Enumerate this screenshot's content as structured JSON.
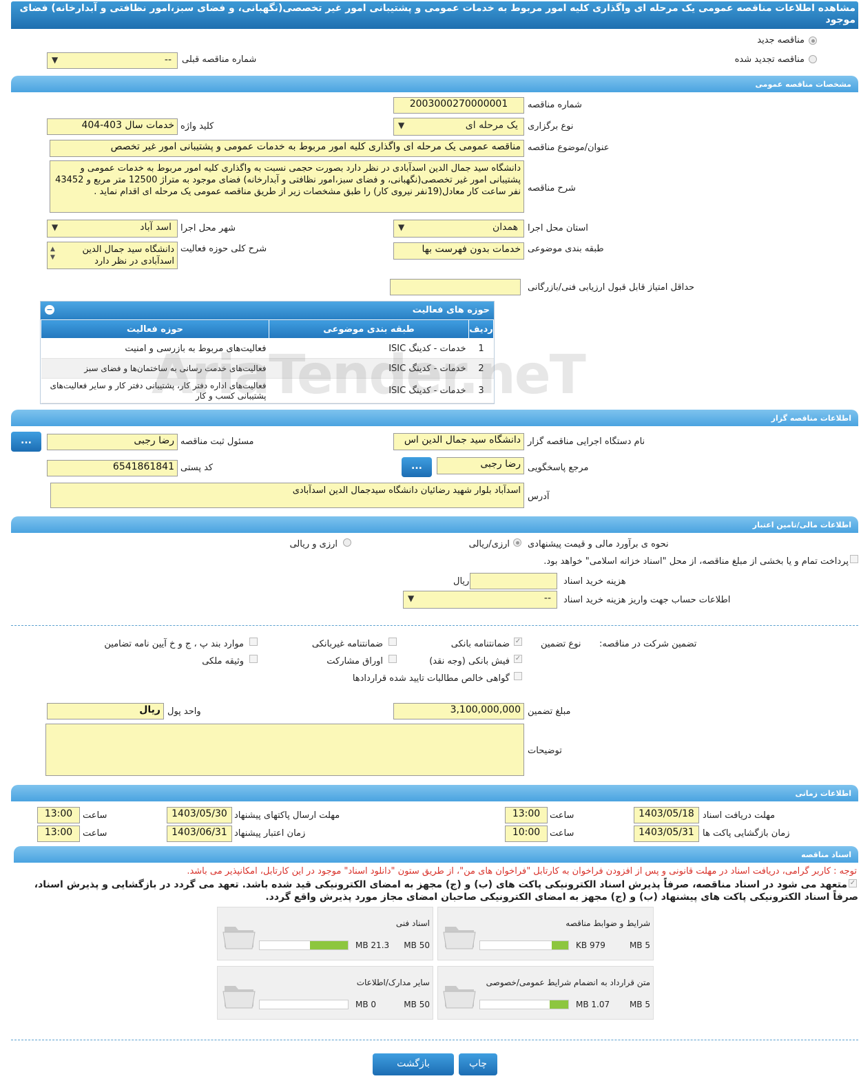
{
  "title": "مشاهده اطلاعات مناقصه عمومی یک مرحله ای واگذاری کلیه امور مربوط به خدمات عمومی و پشتیبانی امور غیر تخصصی(نگهبانی، و فضای سبز،امور نظافتی و آبدارخانه) فضای موجود",
  "tender_type": {
    "new": "مناقصه جدید",
    "renewed": "مناقصه تجدید شده",
    "prev_label": "شماره مناقصه قبلی",
    "prev_value": "--"
  },
  "general": {
    "section": "مشخصات مناقصه عمومی",
    "number_label": "شماره مناقصه",
    "number": "2003000270000001",
    "hold_label": "نوع برگزاری",
    "hold": "یک مرحله ای",
    "keyword_label": "کلید واژه",
    "keyword": "خدمات سال 403-404",
    "subject_label": "عنوان/موضوع مناقصه",
    "subject": "مناقصه عمومی یک مرحله ای واگذاری کلیه امور مربوط به خدمات عمومی و پشتیبانی امور غیر تخصص",
    "desc_label": "شرح مناقصه",
    "desc": "دانشگاه سید جمال الدین اسدآبادی در نظر دارد بصورت حجمی نسبت به واگذاری کلیه امور مربوط به خدمات عمومی و پشتیبانی امور غیر تخصصی(نگهبانی، و فضای سبز،امور نظافتی و آبدارخانه) فضای موجود به متراژ 12500  متر مربع و 43452  نفر ساعت کار معادل(19نفر نیروی کار)  را طبق مشخصات زیر از طریق مناقصه عمومی یک مرحله ای اقدام نماید .",
    "province_label": "استان محل اجرا",
    "province": "همدان",
    "city_label": "شهر محل اجرا",
    "city": "اسد آباد",
    "category_label": "طبقه بندی موضوعی",
    "category": "خدمات بدون فهرست بها",
    "scope_label": "شرح کلی حوزه فعالیت",
    "scope": "دانشگاه سید جمال الدین اسدآبادی در نظر دارد",
    "min_score_label": "حداقل امتیاز قابل قبول ارزیابی فنی/بازرگانی",
    "min_score": ""
  },
  "activities": {
    "title": "حوزه های فعالیت",
    "headers": [
      "ردیف",
      "طبقه بندی موضوعی",
      "حوزه فعالیت"
    ],
    "rows": [
      [
        "1",
        "خدمات - کدینگ ISIC",
        "فعالیت‌های مربوط به بازرسی و امنیت"
      ],
      [
        "2",
        "خدمات - کدینگ ISIC",
        "فعالیت‌های خدمت رسانی به ساختمان‌ها و فضای سبز"
      ],
      [
        "3",
        "خدمات - کدینگ ISIC",
        "فعالیت‌های  اداره دفتر کار، پشتیبانی دفتر کار و سایر فعالیت‌های پشتیبانی کسب و کار"
      ]
    ]
  },
  "watermark": "AriaTender.neT",
  "organizer": {
    "section": "اطلاعات مناقصه گزار",
    "org_label": "نام دستگاه اجرایی مناقصه گزار",
    "org": "دانشگاه سید جمال الدین اس",
    "registrar_label": "مسئول ثبت مناقصه",
    "registrar": "رضا  رجبی",
    "ref_label": "مرجع پاسخگویی",
    "ref": "رضا رجبی",
    "postal_label": "کد پستی",
    "postal": "6541861841",
    "address_label": "آدرس",
    "address": "اسدآباد بلوار شهید رضائیان دانشگاه سیدجمال الدین اسدآبادی",
    "dots": "..."
  },
  "finance": {
    "section": "اطلاعات مالی/تامین اعتبار",
    "method_label": "نحوه ی برآورد مالی و قیمت پیشنهادی",
    "method_rial": "ارزی/ریالی",
    "method_both": "ارزی و ریالی",
    "treasury": "پرداخت تمام و یا بخشی از مبلغ مناقصه، از محل \"اسناد خزانه اسلامی\" خواهد بود.",
    "doc_cost_label": "هزینه خرید اسناد",
    "doc_cost_unit": "ریال",
    "doc_cost": "",
    "account_label": "اطلاعات حساب جهت واریز هزینه خرید اسناد",
    "account": "--"
  },
  "guarantee": {
    "label": "تضمین شرکت در مناقصه:",
    "type_label": "نوع تضمین",
    "bank": "ضمانتنامه بانکی",
    "nonbank": "ضمانتنامه غیربانکی",
    "items_bpj": "موارد بند پ ، ج و خ آیین نامه تضامین",
    "cash": "فیش بانکی (وجه نقد)",
    "bonds": "اوراق مشارکت",
    "property": "وثیقه ملکی",
    "receivables": "گواهی خالص مطالبات تایید شده قراردادها",
    "amount_label": "مبلغ تضمین",
    "amount": "3,100,000,000",
    "currency_label": "واحد پول",
    "currency": "ریال",
    "notes_label": "توضیحات",
    "notes": ""
  },
  "timing": {
    "section": "اطلاعات زمانی",
    "receive_label": "مهلت دریافت اسناد",
    "receive_date": "1403/05/18",
    "receive_time": "13:00",
    "submit_label": "مهلت ارسال پاکتهای پیشنهاد",
    "submit_date": "1403/05/30",
    "submit_time": "13:00",
    "open_label": "زمان بازگشایی پاکت ها",
    "open_date": "1403/05/31",
    "open_time": "10:00",
    "valid_label": "زمان اعتبار پیشنهاد",
    "valid_date": "1403/06/31",
    "valid_time": "13:00",
    "time_label": "ساعت"
  },
  "docs": {
    "section": "اسناد مناقصه",
    "notice": "توجه : کاربر گرامی، دریافت اسناد در مهلت قانونی و پس از افزودن فراخوان به کارتابل \"فراخوان های من\"، از طریق ستون \"دانلود اسناد\" موجود در این کارتابل، امکانپذیر می باشد.",
    "commit1": "متعهد می شود در اسناد مناقصه، صرفاً پذیرش اسناد الکترونیکی پاکت های (ب) و (ج) مجهز به امضای الکترونیکی قید شده باشد. تعهد می گردد در بازگشایی و پذیرش اسناد،",
    "commit2": "صرفاً اسناد الکترونیکی پاکت های پیشنهاد (ب) و (ج) مجهز به امضای الکترونیکی صاحبان امضای مجاز مورد پذیرش واقع گردد.",
    "items": [
      {
        "title": "شرایط و ضوابط مناقصه",
        "max": "5 MB",
        "used": "979 KB",
        "pct": 19
      },
      {
        "title": "اسناد فنی",
        "max": "50 MB",
        "used": "21.3 MB",
        "pct": 43
      },
      {
        "title": "متن قرارداد به انضمام شرایط عمومی/خصوصی",
        "max": "5 MB",
        "used": "1.07 MB",
        "pct": 21
      },
      {
        "title": "سایر مدارک/اطلاعات",
        "max": "50 MB",
        "used": "0 MB",
        "pct": 0
      }
    ]
  },
  "buttons": {
    "print": "چاپ",
    "back": "بازگشت"
  },
  "colors": {
    "field": "#fbf8b8",
    "accent": "#2a80c4",
    "section": "#5aaee6",
    "progress": "#8dc63f",
    "notice": "#d8312a"
  },
  "icons": {
    "folder": "folder-icon",
    "dropdown": "chevron-down-icon"
  }
}
